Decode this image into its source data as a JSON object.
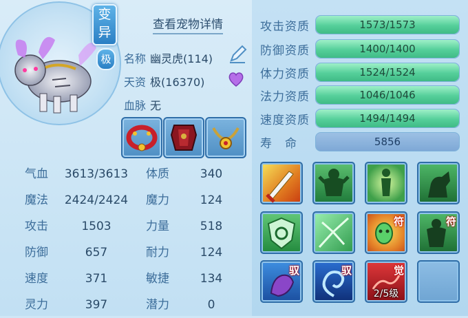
{
  "header": {
    "detail_link": "查看宠物详情"
  },
  "badges": {
    "variant": [
      "变",
      "异"
    ],
    "grade": "极"
  },
  "info": {
    "name_label": "名称",
    "name_value": "幽灵虎(114)",
    "aptitude_label": "天资",
    "aptitude_value": "极(16370)",
    "bloodline_label": "血脉",
    "bloodline_value": "无"
  },
  "equipment": [
    {
      "name": "collar-equipment",
      "icon": "red-collar"
    },
    {
      "name": "armor-equipment",
      "icon": "red-armor"
    },
    {
      "name": "amulet-equipment",
      "icon": "gold-necklace"
    }
  ],
  "stats": [
    {
      "l1": "气血",
      "v1": "3613/3613",
      "l2": "体质",
      "v2": "340"
    },
    {
      "l1": "魔法",
      "v1": "2424/2424",
      "l2": "魔力",
      "v2": "124"
    },
    {
      "l1": "攻击",
      "v1": "1503",
      "l2": "力量",
      "v2": "518"
    },
    {
      "l1": "防御",
      "v1": "657",
      "l2": "耐力",
      "v2": "124"
    },
    {
      "l1": "速度",
      "v1": "371",
      "l2": "敏捷",
      "v2": "134"
    },
    {
      "l1": "灵力",
      "v1": "397",
      "l2": "潜力",
      "v2": "0"
    }
  ],
  "aptitudes": [
    {
      "label": "攻击资质",
      "text": "1573/1573",
      "fill": 1.0
    },
    {
      "label": "防御资质",
      "text": "1400/1400",
      "fill": 1.0
    },
    {
      "label": "体力资质",
      "text": "1524/1524",
      "fill": 1.0
    },
    {
      "label": "法力资质",
      "text": "1046/1046",
      "fill": 1.0
    },
    {
      "label": "速度资质",
      "text": "1494/1494",
      "fill": 1.0
    }
  ],
  "lifespan": {
    "label": "寿　命",
    "value": "5856"
  },
  "skills": [
    {
      "name": "skill-sword-strike",
      "tag": "",
      "level": ""
    },
    {
      "name": "skill-roaring-giant",
      "tag": "",
      "level": ""
    },
    {
      "name": "skill-light-figure",
      "tag": "",
      "level": ""
    },
    {
      "name": "skill-horse-warrior",
      "tag": "",
      "level": ""
    },
    {
      "name": "skill-shield",
      "tag": "",
      "level": ""
    },
    {
      "name": "skill-shatter",
      "tag": "",
      "level": ""
    },
    {
      "name": "skill-rune-mask",
      "tag": "符",
      "level": ""
    },
    {
      "name": "skill-rune-giant",
      "tag": "符",
      "level": ""
    },
    {
      "name": "skill-purple-claw",
      "tag": "驭",
      "level": ""
    },
    {
      "name": "skill-water-spiral",
      "tag": "驭",
      "level": ""
    },
    {
      "name": "skill-awaken",
      "tag": "觉",
      "level": "2/5级"
    },
    {
      "name": "skill-empty-slot",
      "tag": "",
      "level": ""
    }
  ]
}
